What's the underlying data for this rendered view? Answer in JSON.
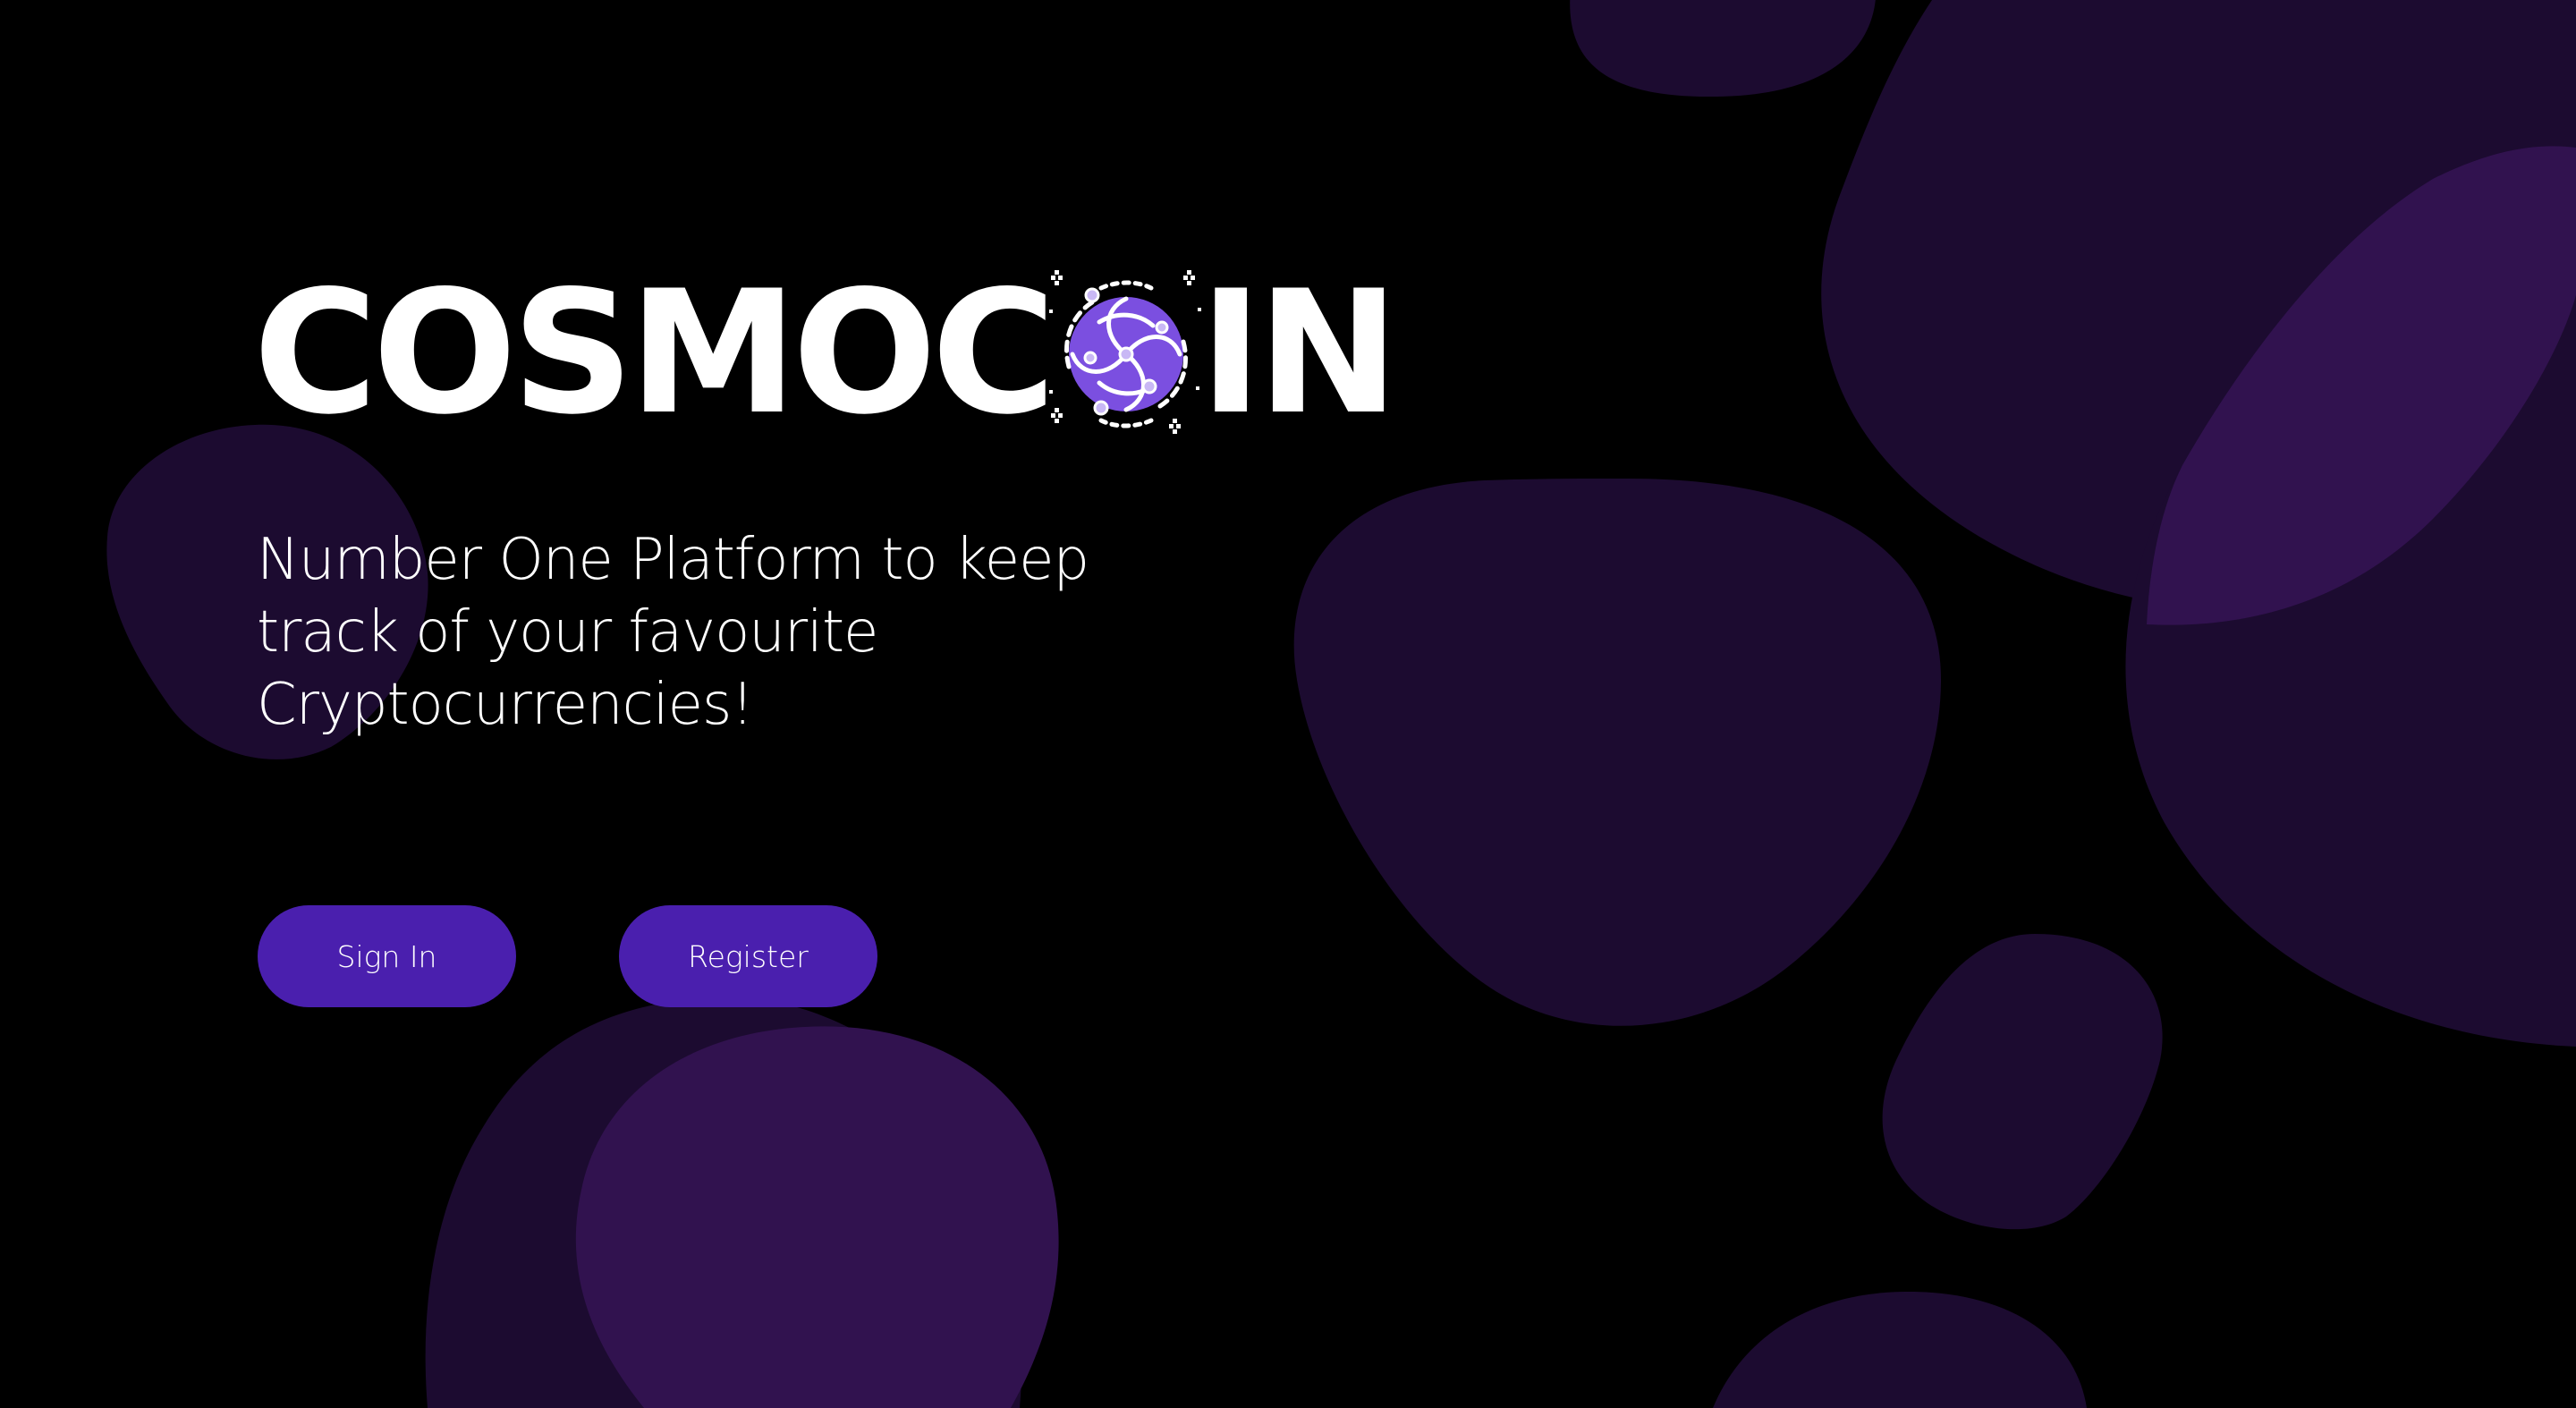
{
  "brand": {
    "name_prefix": "COSMOC",
    "name_suffix": "IN",
    "coin_icon": "galaxy-coin-icon",
    "accent_color": "#7b4fe0",
    "button_color": "#4a1fae",
    "blob_colors": [
      "#1c0b30",
      "#31124f"
    ]
  },
  "hero": {
    "tagline_line1": "Number One Platform to keep",
    "tagline_line2": "track of your favourite",
    "tagline_line3": "Cryptocurrencies!"
  },
  "actions": {
    "sign_in_label": "Sign In",
    "register_label": "Register"
  }
}
